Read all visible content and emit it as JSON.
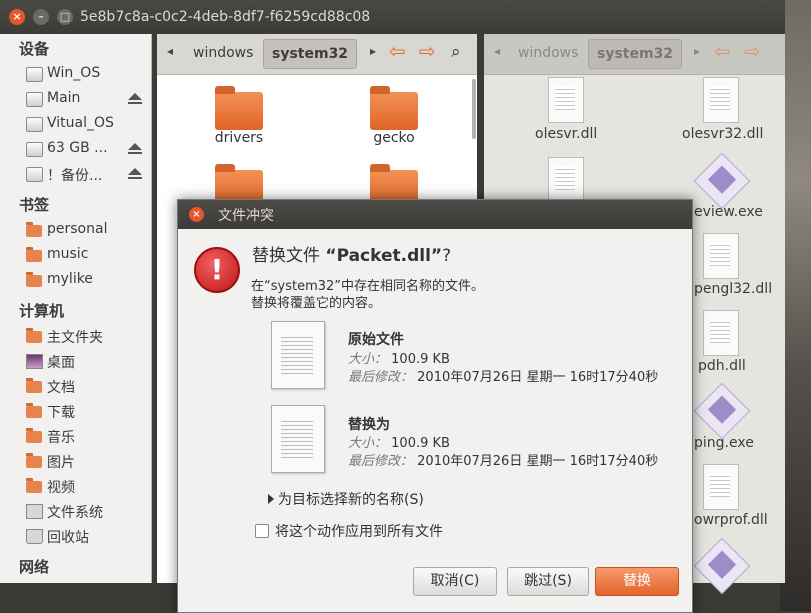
{
  "window": {
    "title": "5e8b7c8a-c0c2-4deb-8df7-f6259cd88c08"
  },
  "sidebar": {
    "sections": {
      "devices": "设备",
      "bookmarks": "书签",
      "computer": "计算机",
      "network": "网络"
    },
    "devices": [
      {
        "label": "Win_OS",
        "icon": "drive-icon",
        "eject": false
      },
      {
        "label": "Main",
        "icon": "drive-icon",
        "eject": true
      },
      {
        "label": "Vitual_OS",
        "icon": "drive-icon",
        "eject": false
      },
      {
        "label": "63 GB ...",
        "icon": "drive-icon",
        "eject": true
      },
      {
        "label": "！备份...",
        "icon": "drive-icon",
        "eject": true
      }
    ],
    "bookmarks": [
      {
        "label": "personal",
        "icon": "folder-icon"
      },
      {
        "label": "music",
        "icon": "folder-icon"
      },
      {
        "label": "mylike",
        "icon": "folder-icon"
      }
    ],
    "computer": [
      {
        "label": "主文件夹",
        "icon": "home-icon"
      },
      {
        "label": "桌面",
        "icon": "desktop-icon"
      },
      {
        "label": "文档",
        "icon": "documents-icon"
      },
      {
        "label": "下载",
        "icon": "downloads-icon"
      },
      {
        "label": "音乐",
        "icon": "music-icon"
      },
      {
        "label": "图片",
        "icon": "pictures-icon"
      },
      {
        "label": "视频",
        "icon": "videos-icon"
      },
      {
        "label": "文件系统",
        "icon": "filesystem-icon"
      },
      {
        "label": "回收站",
        "icon": "trash-icon"
      }
    ]
  },
  "left_pane": {
    "breadcrumb": [
      "windows",
      "system32"
    ],
    "folders": [
      "drivers",
      "gecko"
    ]
  },
  "right_pane": {
    "breadcrumb": [
      "windows",
      "system32"
    ],
    "files": [
      "olesvr.dll",
      "olesvr32.dll",
      "eview.exe",
      "pengl32.dll",
      "pdh.dll",
      "ping.exe",
      "owrprof.dll"
    ]
  },
  "dialog": {
    "title": "文件冲突",
    "heading_prefix": "替换文件",
    "heading_file": "“Packet.dll”",
    "heading_suffix": "?",
    "message_line1": "在“system32”中存在相同名称的文件。",
    "message_line2": "替换将覆盖它的内容。",
    "original": {
      "title": "原始文件",
      "size_label": "大小：",
      "size": "100.9 KB",
      "modified_label": "最后修改：",
      "modified": "2010年07月26日 星期一 16时17分40秒"
    },
    "replacement": {
      "title": "替换为",
      "size_label": "大小：",
      "size": "100.9 KB",
      "modified_label": "最后修改：",
      "modified": "2010年07月26日 星期一 16时17分40秒"
    },
    "rename_expander": "为目标选择新的名称(S)",
    "apply_all": "将这个动作应用到所有文件",
    "buttons": {
      "cancel": "取消(C)",
      "skip": "跳过(S)",
      "replace": "替换"
    }
  }
}
